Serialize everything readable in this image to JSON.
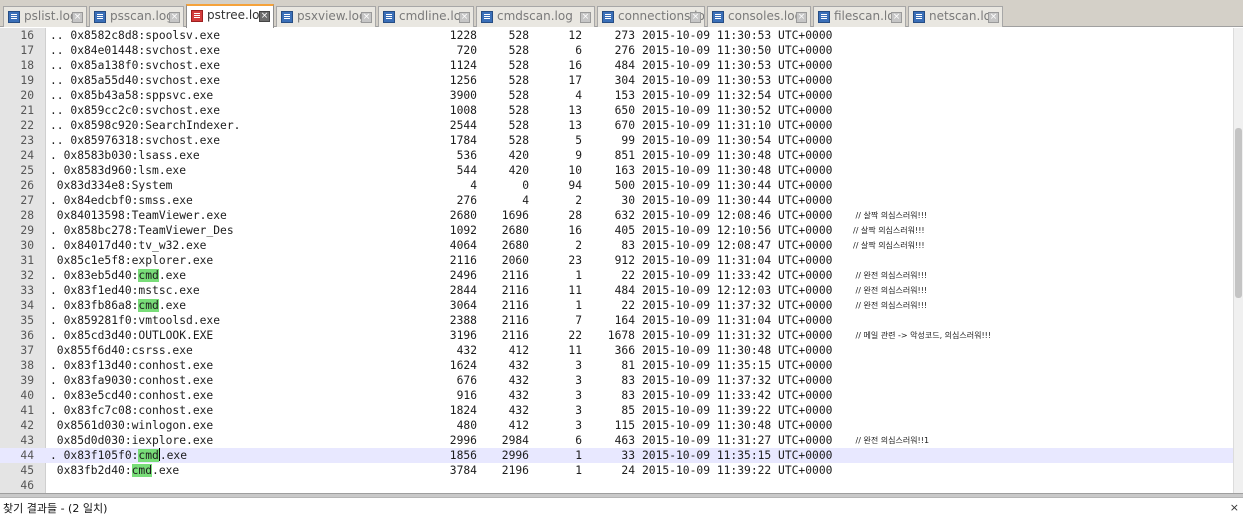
{
  "tabs": [
    {
      "label": "pslist.log",
      "active": false
    },
    {
      "label": "psscan.log",
      "active": false
    },
    {
      "label": "pstree.log",
      "active": true
    },
    {
      "label": "psxview.log",
      "active": false
    },
    {
      "label": "cmdline.log",
      "active": false
    },
    {
      "label": "cmdscan.log",
      "active": false
    },
    {
      "label": "connections.log",
      "active": false
    },
    {
      "label": "consoles.log",
      "active": false
    },
    {
      "label": "filescan.log",
      "active": false
    },
    {
      "label": "netscan.log",
      "active": false
    }
  ],
  "tab_close_glyph": "×",
  "highlight_term": "cmd",
  "rows": [
    {
      "ln": "16",
      "name": ".. 0x8582c8d8:spoolsv.exe",
      "pid": "1228",
      "ppid": "528",
      "thds": "12",
      "hnds": "273",
      "time": "2015-10-09 11:30:53 UTC+0000",
      "comment": ""
    },
    {
      "ln": "17",
      "name": ".. 0x84e01448:svchost.exe",
      "pid": "720",
      "ppid": "528",
      "thds": "6",
      "hnds": "276",
      "time": "2015-10-09 11:30:50 UTC+0000",
      "comment": ""
    },
    {
      "ln": "18",
      "name": ".. 0x85a138f0:svchost.exe",
      "pid": "1124",
      "ppid": "528",
      "thds": "16",
      "hnds": "484",
      "time": "2015-10-09 11:30:53 UTC+0000",
      "comment": ""
    },
    {
      "ln": "19",
      "name": ".. 0x85a55d40:svchost.exe",
      "pid": "1256",
      "ppid": "528",
      "thds": "17",
      "hnds": "304",
      "time": "2015-10-09 11:30:53 UTC+0000",
      "comment": ""
    },
    {
      "ln": "20",
      "name": ".. 0x85b43a58:sppsvc.exe",
      "pid": "3900",
      "ppid": "528",
      "thds": "4",
      "hnds": "153",
      "time": "2015-10-09 11:32:54 UTC+0000",
      "comment": ""
    },
    {
      "ln": "21",
      "name": ".. 0x859cc2c0:svchost.exe",
      "pid": "1008",
      "ppid": "528",
      "thds": "13",
      "hnds": "650",
      "time": "2015-10-09 11:30:52 UTC+0000",
      "comment": ""
    },
    {
      "ln": "22",
      "name": ".. 0x8598c920:SearchIndexer.",
      "pid": "2544",
      "ppid": "528",
      "thds": "13",
      "hnds": "670",
      "time": "2015-10-09 11:31:10 UTC+0000",
      "comment": ""
    },
    {
      "ln": "23",
      "name": ".. 0x85976318:svchost.exe",
      "pid": "1784",
      "ppid": "528",
      "thds": "5",
      "hnds": "99",
      "time": "2015-10-09 11:30:54 UTC+0000",
      "comment": ""
    },
    {
      "ln": "24",
      "name": ". 0x8583b030:lsass.exe",
      "pid": "536",
      "ppid": "420",
      "thds": "9",
      "hnds": "851",
      "time": "2015-10-09 11:30:48 UTC+0000",
      "comment": ""
    },
    {
      "ln": "25",
      "name": ". 0x8583d960:lsm.exe",
      "pid": "544",
      "ppid": "420",
      "thds": "10",
      "hnds": "163",
      "time": "2015-10-09 11:30:48 UTC+0000",
      "comment": ""
    },
    {
      "ln": "26",
      "name": " 0x83d334e8:System",
      "pid": "4",
      "ppid": "0",
      "thds": "94",
      "hnds": "500",
      "time": "2015-10-09 11:30:44 UTC+0000",
      "comment": ""
    },
    {
      "ln": "27",
      "name": ". 0x84edcbf0:smss.exe",
      "pid": "276",
      "ppid": "4",
      "thds": "2",
      "hnds": "30",
      "time": "2015-10-09 11:30:44 UTC+0000",
      "comment": ""
    },
    {
      "ln": "28",
      "name": " 0x84013598:TeamViewer.exe",
      "pid": "2680",
      "ppid": "1696",
      "thds": "28",
      "hnds": "632",
      "time": "2015-10-09 12:08:46 UTC+0000",
      "comment": " // 살짝 의심스러워!!!"
    },
    {
      "ln": "29",
      "name": ". 0x858bc278:TeamViewer_Des",
      "pid": "1092",
      "ppid": "2680",
      "thds": "16",
      "hnds": "405",
      "time": "2015-10-09 12:10:56 UTC+0000",
      "comment": "// 살짝 의심스러워!!!"
    },
    {
      "ln": "30",
      "name": ". 0x84017d40:tv_w32.exe",
      "pid": "4064",
      "ppid": "2680",
      "thds": "2",
      "hnds": "83",
      "time": "2015-10-09 12:08:47 UTC+0000",
      "comment": "// 살짝 의심스러워!!!"
    },
    {
      "ln": "31",
      "name": " 0x85c1e5f8:explorer.exe",
      "pid": "2116",
      "ppid": "2060",
      "thds": "23",
      "hnds": "912",
      "time": "2015-10-09 11:31:04 UTC+0000",
      "comment": ""
    },
    {
      "ln": "32",
      "name": ". 0x83eb5d40:cmd.exe",
      "pid": "2496",
      "ppid": "2116",
      "thds": "1",
      "hnds": "22",
      "time": "2015-10-09 11:33:42 UTC+0000",
      "comment": " // 완전 의심스러워!!!"
    },
    {
      "ln": "33",
      "name": ". 0x83f1ed40:mstsc.exe",
      "pid": "2844",
      "ppid": "2116",
      "thds": "11",
      "hnds": "484",
      "time": "2015-10-09 12:12:03 UTC+0000",
      "comment": " // 완전 의심스러워!!!"
    },
    {
      "ln": "34",
      "name": ". 0x83fb86a8:cmd.exe",
      "pid": "3064",
      "ppid": "2116",
      "thds": "1",
      "hnds": "22",
      "time": "2015-10-09 11:37:32 UTC+0000",
      "comment": " // 완전 의심스러워!!!"
    },
    {
      "ln": "35",
      "name": ". 0x859281f0:vmtoolsd.exe",
      "pid": "2388",
      "ppid": "2116",
      "thds": "7",
      "hnds": "164",
      "time": "2015-10-09 11:31:04 UTC+0000",
      "comment": ""
    },
    {
      "ln": "36",
      "name": ". 0x85cd3d40:OUTLOOK.EXE",
      "pid": "3196",
      "ppid": "2116",
      "thds": "22",
      "hnds": "1678",
      "time": "2015-10-09 11:31:32 UTC+0000",
      "comment": " // 메일 관련 -> 악성코드, 의심스러워!!!"
    },
    {
      "ln": "37",
      "name": " 0x855f6d40:csrss.exe",
      "pid": "432",
      "ppid": "412",
      "thds": "11",
      "hnds": "366",
      "time": "2015-10-09 11:30:48 UTC+0000",
      "comment": ""
    },
    {
      "ln": "38",
      "name": ". 0x83f13d40:conhost.exe",
      "pid": "1624",
      "ppid": "432",
      "thds": "3",
      "hnds": "81",
      "time": "2015-10-09 11:35:15 UTC+0000",
      "comment": ""
    },
    {
      "ln": "39",
      "name": ". 0x83fa9030:conhost.exe",
      "pid": "676",
      "ppid": "432",
      "thds": "3",
      "hnds": "83",
      "time": "2015-10-09 11:37:32 UTC+0000",
      "comment": ""
    },
    {
      "ln": "40",
      "name": ". 0x83e5cd40:conhost.exe",
      "pid": "916",
      "ppid": "432",
      "thds": "3",
      "hnds": "83",
      "time": "2015-10-09 11:33:42 UTC+0000",
      "comment": ""
    },
    {
      "ln": "41",
      "name": ". 0x83fc7c08:conhost.exe",
      "pid": "1824",
      "ppid": "432",
      "thds": "3",
      "hnds": "85",
      "time": "2015-10-09 11:39:22 UTC+0000",
      "comment": ""
    },
    {
      "ln": "42",
      "name": " 0x8561d030:winlogon.exe",
      "pid": "480",
      "ppid": "412",
      "thds": "3",
      "hnds": "115",
      "time": "2015-10-09 11:30:48 UTC+0000",
      "comment": ""
    },
    {
      "ln": "43",
      "name": " 0x85d0d030:iexplore.exe",
      "pid": "2996",
      "ppid": "2984",
      "thds": "6",
      "hnds": "463",
      "time": "2015-10-09 11:31:27 UTC+0000",
      "comment": " // 완전 의심스러워!!1"
    },
    {
      "ln": "44",
      "name": ". 0x83f105f0:cmd.exe",
      "pid": "1856",
      "ppid": "2996",
      "thds": "1",
      "hnds": "33",
      "time": "2015-10-09 11:35:15 UTC+0000",
      "comment": "",
      "current": true
    },
    {
      "ln": "45",
      "name": " 0x83fb2d40:cmd.exe",
      "pid": "3784",
      "ppid": "2196",
      "thds": "1",
      "hnds": "24",
      "time": "2015-10-09 11:39:22 UTC+0000",
      "comment": ""
    },
    {
      "ln": "46",
      "name": "",
      "pid": "",
      "ppid": "",
      "thds": "",
      "hnds": "",
      "time": "",
      "comment": ""
    }
  ],
  "find_panel": {
    "title": "찾기 결과들 - (2 일치)",
    "close_glyph": "×"
  }
}
